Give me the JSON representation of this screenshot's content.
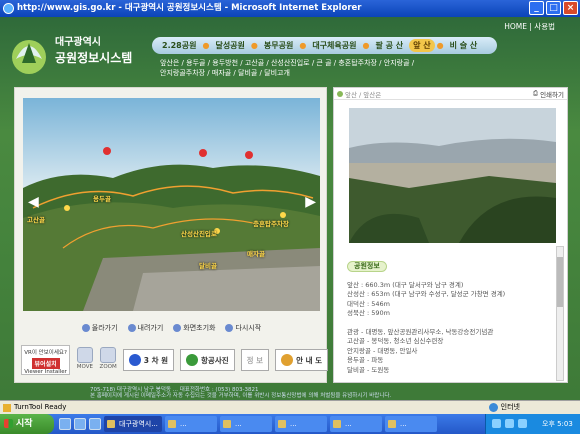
{
  "window": {
    "title": "http://www.gis.go.kr - 대구광역시 공원정보시스템 - Microsoft Internet Explorer"
  },
  "header": {
    "logo_line1": "대구광역시",
    "logo_line2": "공원정보시스템",
    "home_link": "HOME",
    "sitemap_link": "사용법"
  },
  "nav": {
    "items": [
      {
        "label": "2.28공원"
      },
      {
        "label": "달성공원"
      },
      {
        "label": "봉무공원"
      },
      {
        "label": "대구체육공원"
      },
      {
        "label": "팔 공 산"
      },
      {
        "label": "앞 산"
      },
      {
        "label": "비 슬 산"
      }
    ],
    "active_index": 5
  },
  "sublinks": {
    "line1": "앞산은 / 용두골 / 용두방천 / 고산골 / 산성산진입로 / 큰 골 / 충혼탑주차장 / 안지랑골 /",
    "line2": "안지랑골주차장 / 매자골 / 달비골 / 달비고개"
  },
  "map": {
    "labels": [
      "고산골",
      "산성산진입로",
      "충혼탑주차장",
      "매자골",
      "달비골",
      "용두골"
    ],
    "controls": [
      "올라가기",
      "내려가기",
      "화면초기화",
      "다시시작"
    ]
  },
  "tools": {
    "viewer_line1": "VR이 안보이세요?",
    "viewer_button": "뷰어설치",
    "viewer_line2": "Viewer Installer",
    "icon1_label": "MOVE",
    "icon2_label": "ZOOM",
    "btn_3d": "3 차 원",
    "btn_panorama": "항공사진",
    "btn_disabled": "정 보",
    "btn_guide": "안 내 도"
  },
  "info_panel": {
    "breadcrumb": "앞산 / 앞산은",
    "print_label": "인쇄하기",
    "section_tag": "공원정보",
    "lines": [
      "앞산 : 660.3m (대구 달서구와 남구 경계)",
      "산성산 : 653m (대구 남구와 수성구, 달성군 가창면 경계)",
      "대덕산 : 546m",
      "성북산 : 590m",
      "",
      "관광 - 대명동, 앞산공원관리사무소, 낙동강승전기념관",
      "고산골 - 봉덕동, 청소년 심신수련장",
      "안지랑골 - 대명동, 안일사",
      "용두골 - 파동",
      "달비골 - 도원동"
    ]
  },
  "footer": {
    "line1": "705-718) 대구광역시 남구 봉덕동 ... 대표전화번호 : (053) 803-3821",
    "line2": "본 홈페이지에 게시된 이메일주소가 자동 수집되는 것을 거부하며, 이를 위반시 정보통신망법에 의해 처벌됨을 유념하시기 바랍니다."
  },
  "statusbar": {
    "text": "TurnTool Ready",
    "zone": "인터넷"
  },
  "taskbar": {
    "start": "시작",
    "clock": "오후 5:03",
    "tasks": [
      "대구광역시...",
      "...",
      "...",
      "...",
      "...",
      "...",
      "..."
    ]
  }
}
